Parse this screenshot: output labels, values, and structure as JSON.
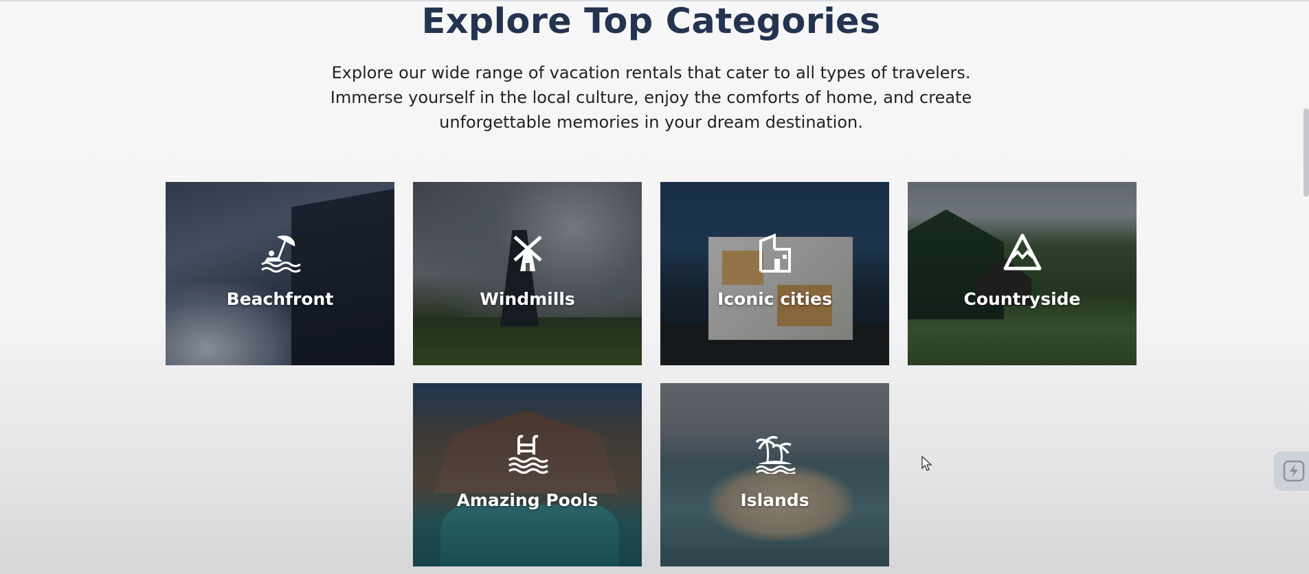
{
  "section": {
    "heading": "Explore Top Categories",
    "intro": "Explore our wide range of vacation rentals that cater to all types of travelers. Immerse yourself in the local culture, enjoy the comforts of home, and create unforgettable memories in your dream destination."
  },
  "categories": [
    {
      "label": "Beachfront",
      "icon": "beach-umbrella-icon"
    },
    {
      "label": "Windmills",
      "icon": "windmill-icon"
    },
    {
      "label": "Iconic cities",
      "icon": "city-building-icon"
    },
    {
      "label": "Countryside",
      "icon": "mountain-icon"
    },
    {
      "label": "Amazing Pools",
      "icon": "pool-ladder-icon"
    },
    {
      "label": "Islands",
      "icon": "palm-island-icon"
    }
  ],
  "colors": {
    "heading": "#24344f",
    "text": "#222222",
    "card_label": "#ffffff"
  }
}
